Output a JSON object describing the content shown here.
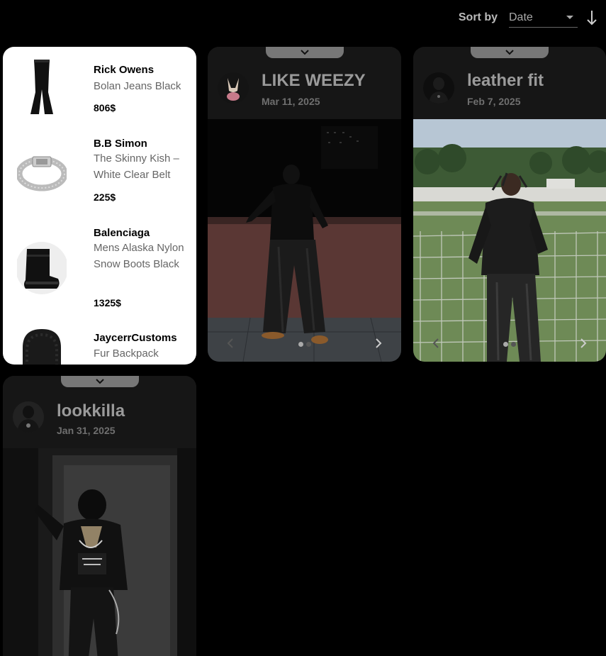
{
  "sort": {
    "label": "Sort by",
    "value": "Date",
    "direction": "descending"
  },
  "products": [
    {
      "brand": "Rick Owens",
      "name": "Bolan Jeans Black",
      "price": "806$",
      "icon": "flared-jeans-icon"
    },
    {
      "brand": "B.B Simon",
      "name": "The Skinny Kish – White Clear Belt",
      "price": "225$",
      "icon": "studded-belt-icon"
    },
    {
      "brand": "Balenciaga",
      "name": "Mens Alaska Nylon Snow Boots Black",
      "price": "1325$",
      "icon": "snow-boot-icon"
    },
    {
      "brand": "JaycerrCustoms",
      "name": "Fur Backpack",
      "price": "",
      "icon": "fur-backpack-icon"
    }
  ],
  "posts": [
    {
      "title": "LIKE WEEZY",
      "date": "Mar 11, 2025",
      "slides": 2,
      "active_slide": 1
    },
    {
      "title": "leather fit",
      "date": "Feb 7, 2025",
      "slides": 2,
      "active_slide": 1
    },
    {
      "title": "lookkilla",
      "date": "Jan 31, 2025"
    }
  ],
  "colors": {
    "background": "#000000",
    "card": "#131313",
    "tab": "#777777"
  }
}
